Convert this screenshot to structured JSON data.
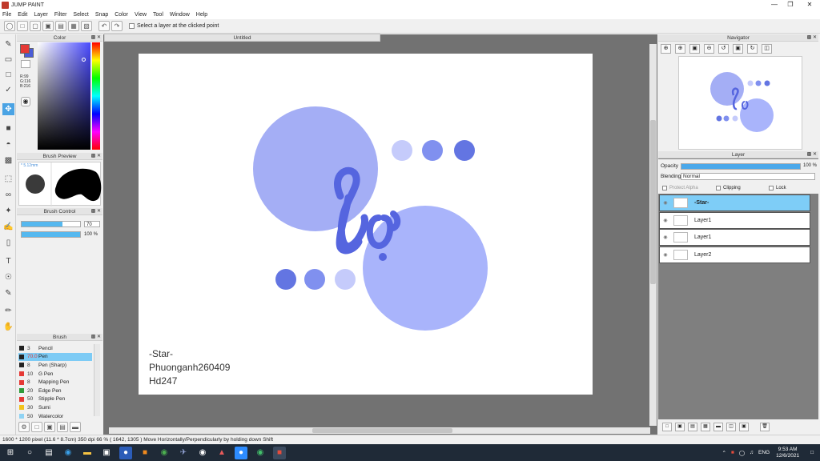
{
  "window": {
    "title": "JUMP PAINT",
    "minimize": "—",
    "maximize": "❐",
    "close": "✕"
  },
  "menu": [
    "File",
    "Edit",
    "Layer",
    "Filter",
    "Select",
    "Snap",
    "Color",
    "View",
    "Tool",
    "Window",
    "Help"
  ],
  "toolbar": {
    "select_layer_label": "Select a layer at the clicked point"
  },
  "color_panel": {
    "title": "Color",
    "r": "R:99",
    "g": "G:116",
    "b": "B:216",
    "fg_color": "#e53935",
    "bg_color": "#4a5cd8"
  },
  "brush_preview": {
    "title": "Brush Preview",
    "size": "* 5.12mm"
  },
  "brush_control": {
    "title": "Brush Control",
    "size_value": "70",
    "opacity_value": "100 %",
    "size_fraction": 0.7,
    "opacity_fraction": 1.0
  },
  "brush_list": {
    "title": "Brush",
    "items": [
      {
        "size": "3",
        "name": "Pencil",
        "color": "#222222"
      },
      {
        "size": "70.0",
        "name": "Pen",
        "color": "#222222"
      },
      {
        "size": "8",
        "name": "Pen (Sharp)",
        "color": "#222222"
      },
      {
        "size": "10",
        "name": "G Pen",
        "color": "#e53935"
      },
      {
        "size": "8",
        "name": "Mapping Pen",
        "color": "#e53935"
      },
      {
        "size": "20",
        "name": "Edge Pen",
        "color": "#2e9b3a"
      },
      {
        "size": "50",
        "name": "Stipple Pen",
        "color": "#e53935"
      },
      {
        "size": "30",
        "name": "Sumi",
        "color": "#f2c31b"
      },
      {
        "size": "50",
        "name": "Watercolor",
        "color": "#8fd3f4"
      }
    ]
  },
  "document": {
    "tab_title": "Untitled",
    "text_lines": [
      "-Star-",
      "Phuonganh260409",
      "Hd247"
    ]
  },
  "navigator": {
    "title": "Navigator"
  },
  "layer_panel": {
    "title": "Layer",
    "opacity_label": "Opacity",
    "opacity_value": "100 %",
    "blending_label": "Blending",
    "blending_value": "Normal",
    "protect_alpha": "Protect Alpha",
    "clipping": "Clipping",
    "lock": "Lock",
    "layers": [
      {
        "name": "-Star-",
        "selected": true
      },
      {
        "name": "Layer1",
        "selected": false
      },
      {
        "name": "Layer1",
        "selected": false
      },
      {
        "name": "Layer2",
        "selected": false
      }
    ]
  },
  "status": {
    "text": "1600 * 1200 pixel  (11.6 * 8.7cm)  350 dpi  66 %  ( 1642, 1305 )  Move Horizontally/Perpendicularly by holding down Shift"
  },
  "taskbar": {
    "lang": "ENG",
    "time": "9:53 AM",
    "date": "12/6/2021"
  }
}
